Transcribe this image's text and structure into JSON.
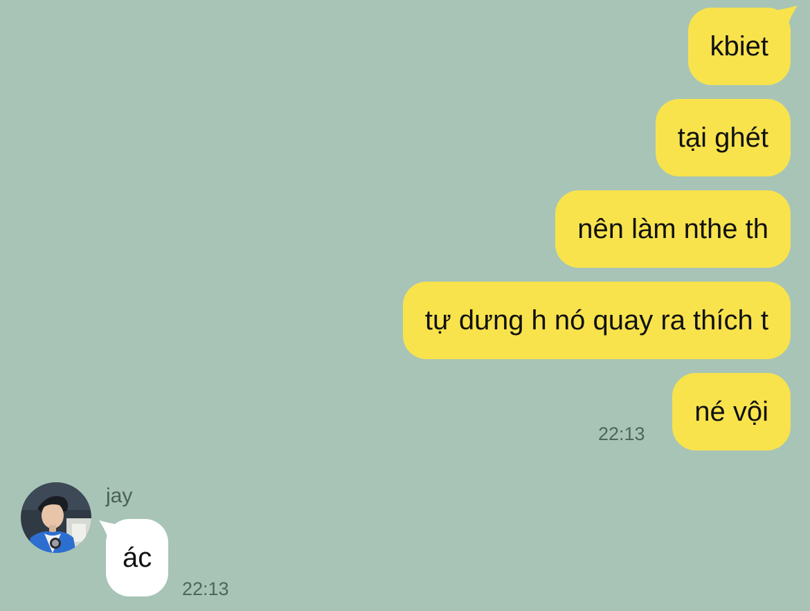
{
  "colors": {
    "background": "#a7c4b6",
    "outgoing_bubble": "#f8e34d",
    "incoming_bubble": "#ffffff",
    "timestamp": "#4f655b"
  },
  "outgoing": {
    "messages": [
      "kbiet",
      "tại ghét",
      "nên làm nthe th",
      "tự dưng h nó quay ra thích t",
      "né vội"
    ],
    "time": "22:13"
  },
  "incoming": {
    "sender": "jay",
    "avatar_icon": "person-avatar-icon",
    "message": "ác",
    "time": "22:13"
  }
}
